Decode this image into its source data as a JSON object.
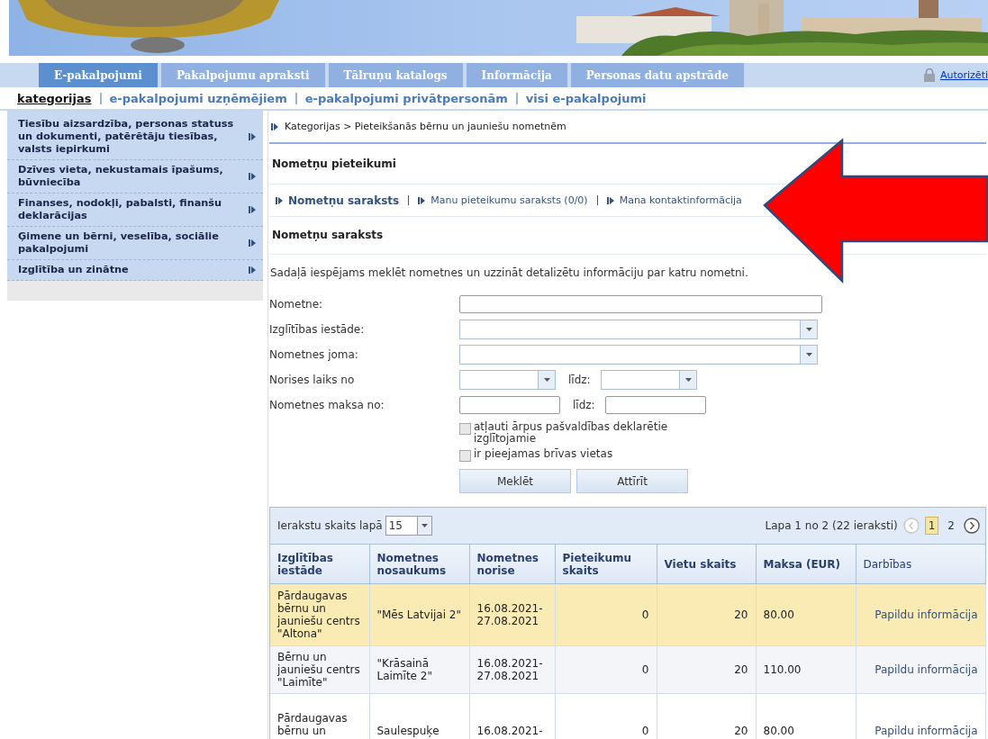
{
  "tabs": [
    {
      "label": "E-pakalpojumi",
      "selected": true
    },
    {
      "label": "Pakalpojumu apraksti",
      "selected": false
    },
    {
      "label": "Tālruņu katalogs",
      "selected": false
    },
    {
      "label": "Informācija",
      "selected": false
    },
    {
      "label": "Personas datu apstrāde",
      "selected": false
    }
  ],
  "login_link": "Autorizēti",
  "subnav": [
    {
      "label": "kategorijas",
      "selected": true
    },
    {
      "label": "e-pakalpojumi uzņēmējiem",
      "selected": false
    },
    {
      "label": "e-pakalpojumi privātpersonām",
      "selected": false
    },
    {
      "label": "visi e-pakalpojumi",
      "selected": false
    }
  ],
  "sidebar": {
    "items": [
      "Tiesību aizsardzība, personas statuss un dokumenti, patērētāju tiesības, valsts iepirkumi",
      "Dzīves vieta, nekustamais īpašums, būvniecība",
      "Finanses, nodokļi, pabalsti, finanšu deklarācijas",
      "Ģimene un bērni, veselība, sociālie pakalpojumi",
      "Izglītība un zinātne"
    ]
  },
  "breadcrumb": "Kategorijas > Pieteikšanās bērnu un jauniešu nometnēm",
  "panel_title": "Nometņu pieteikumi",
  "section_tabs": [
    {
      "label": "Nometņu saraksts",
      "selected": true
    },
    {
      "label": "Manu pieteikumu saraksts (0/0)",
      "selected": false
    },
    {
      "label": "Mana kontaktinformācija",
      "selected": false
    }
  ],
  "section_title": "Nometņu saraksts",
  "description": "Sadaļā iespējams meklēt nometnes un uzzināt detalizētu informāciju par katru nometni.",
  "form": {
    "fields": [
      {
        "label": "Nometne:",
        "kind": "text"
      },
      {
        "label": "Izglītības iestāde:",
        "kind": "select"
      },
      {
        "label": "Nometnes joma:",
        "kind": "select"
      },
      {
        "label": "Norises laiks no",
        "kind": "select_range",
        "to_label": "līdz:"
      },
      {
        "label": "Nometnes maksa no:",
        "kind": "text_range",
        "to_label": "līdz:"
      }
    ],
    "checkboxes": [
      {
        "label": "atļauti ārpus pašvaldības deklarētie izglītojamie",
        "checked": false
      },
      {
        "label": "ir pieejamas brīvas vietas",
        "checked": false
      }
    ],
    "buttons": [
      "Meklēt",
      "Attīrīt"
    ]
  },
  "table": {
    "page_size_label": "Ierakstu skaits lapā",
    "page_size": "15",
    "page_info": "Lapa 1 no 2 (22 ieraksti)",
    "pages": [
      {
        "label": "1",
        "selected": true
      },
      {
        "label": "2",
        "selected": false
      }
    ],
    "columns": [
      "Izglītības iestāde",
      "Nometnes nosaukums",
      "Nometnes norise",
      "Pieteikumu skaits",
      "Vietu skaits",
      "Maksa (EUR)",
      "Darbības"
    ],
    "rows": [
      {
        "selected": true,
        "cells": [
          "Pārdaugavas bērnu un jauniešu centrs \"Altona\"",
          "\"Mēs Latvijai 2\"",
          "16.08.2021-27.08.2021",
          "0",
          "20",
          "80.00",
          "Papildu informācija"
        ]
      },
      {
        "selected": false,
        "cells": [
          "Bērnu un jauniešu centrs \"Laimīte\"",
          "\"Krāsainā Laimīte 2\"",
          "16.08.2021-27.08.2021",
          "0",
          "20",
          "110.00",
          "Papildu informācija"
        ]
      },
      {
        "selected": false,
        "cells": [
          "Pārdaugavas bērnu un",
          "Saulespuķe",
          "16.08.2021-",
          "0",
          "20",
          "80.00",
          "Papildu informācija"
        ]
      }
    ]
  }
}
